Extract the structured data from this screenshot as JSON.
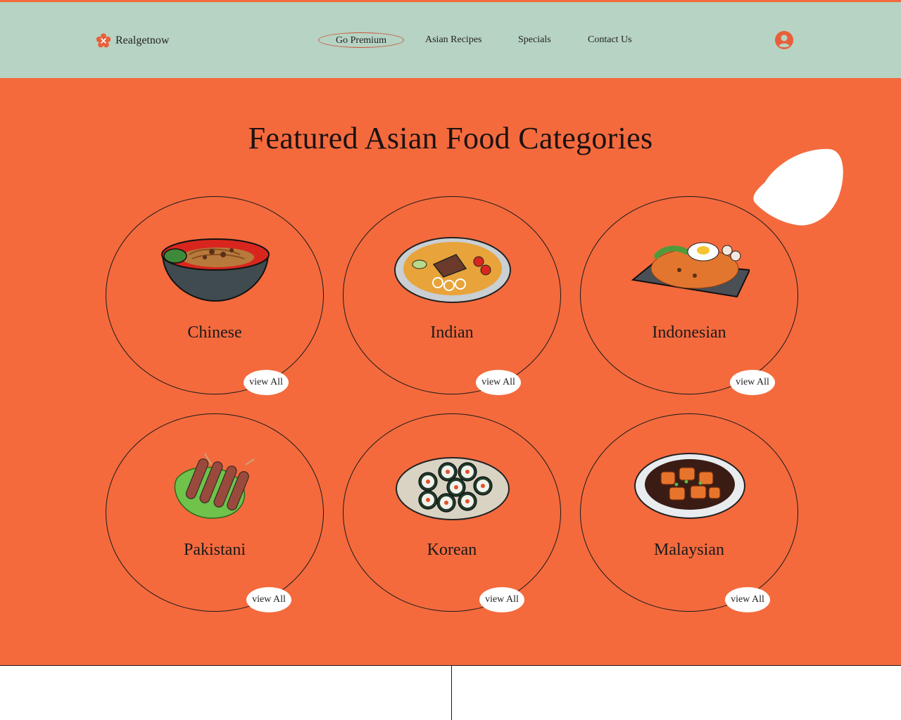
{
  "header": {
    "brand": "Realgetnow",
    "nav": {
      "premium": "Go Premium",
      "asian_recipes": "Asian Recipes",
      "specials": "Specials",
      "contact": "Contact Us"
    }
  },
  "main": {
    "title": "Featured Asian Food Categories",
    "categories": [
      {
        "label": "Chinese",
        "button": "view All"
      },
      {
        "label": "Indian",
        "button": "view All"
      },
      {
        "label": "Indonesian",
        "button": "view All"
      },
      {
        "label": "Pakistani",
        "button": "view All"
      },
      {
        "label": "Korean",
        "button": "view All"
      },
      {
        "label": "Malaysian",
        "button": "view All"
      }
    ]
  },
  "colors": {
    "accent": "#f46a3d",
    "header_bg": "#b7d3c4",
    "text": "#1a1a1a"
  },
  "icons": [
    "flower-logo-icon",
    "user-icon",
    "noodle-bowl-icon",
    "biryani-plate-icon",
    "fried-rice-icon",
    "kebab-skewers-icon",
    "kimbap-plate-icon",
    "curry-bowl-icon"
  ]
}
